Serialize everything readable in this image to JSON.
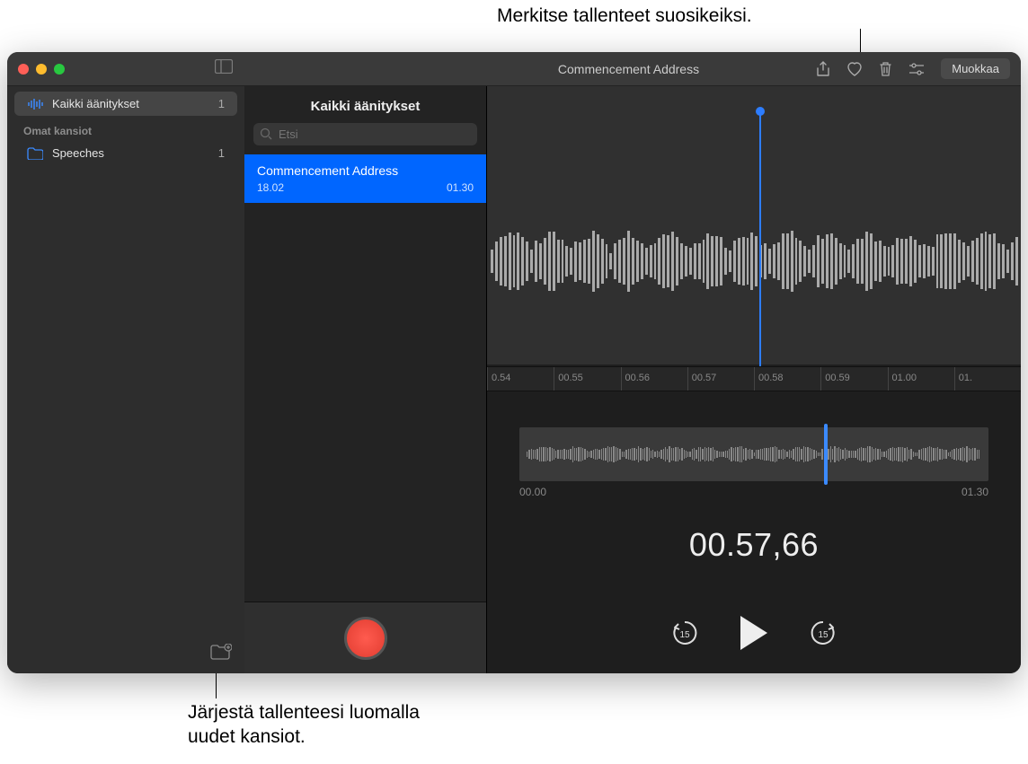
{
  "callouts": {
    "top": "Merkitse tallenteet suosikeiksi.",
    "bottom": "Järjestä tallenteesi luomalla\nuudet kansiot."
  },
  "toolbar": {
    "title": "Commencement Address",
    "edit_label": "Muokkaa"
  },
  "sidebar": {
    "all_label": "Kaikki äänitykset",
    "all_count": "1",
    "section_header": "Omat kansiot",
    "folders": [
      {
        "label": "Speeches",
        "count": "1"
      }
    ]
  },
  "list": {
    "header": "Kaikki äänitykset",
    "search_placeholder": "Etsi",
    "items": [
      {
        "title": "Commencement Address",
        "date": "18.02",
        "duration": "01.30"
      }
    ]
  },
  "timeline": {
    "ticks": [
      "0.54",
      "00.55",
      "00.56",
      "00.57",
      "00.58",
      "00.59",
      "01.00",
      "01."
    ]
  },
  "overview": {
    "start": "00.00",
    "end": "01.30"
  },
  "playback": {
    "timecode": "00.57,66",
    "skip_back_seconds": "15",
    "skip_forward_seconds": "15"
  }
}
